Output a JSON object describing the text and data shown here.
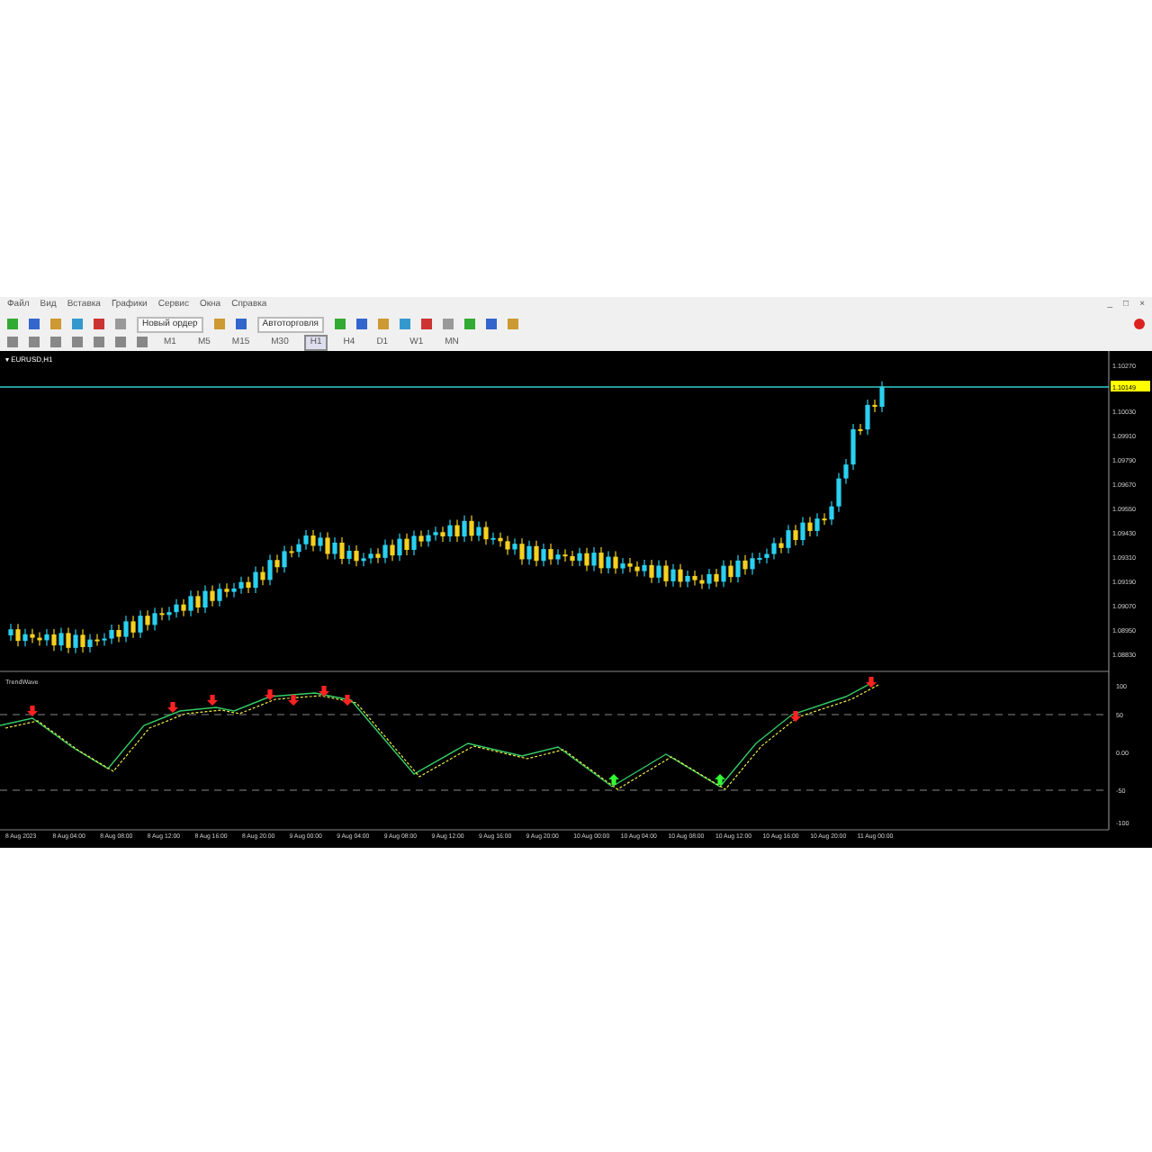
{
  "menu": [
    "Файл",
    "Вид",
    "Вставка",
    "Графики",
    "Сервис",
    "Окна",
    "Справка"
  ],
  "window_controls": [
    "_",
    "□",
    "×"
  ],
  "toolbar": {
    "buttons": [
      {
        "label": "Новый ордер"
      },
      {
        "label": "Автоторговля"
      }
    ]
  },
  "timeframes": [
    {
      "label": "M1",
      "selected": false
    },
    {
      "label": "M5",
      "selected": false
    },
    {
      "label": "M15",
      "selected": false
    },
    {
      "label": "M30",
      "selected": false
    },
    {
      "label": "H1",
      "selected": true
    },
    {
      "label": "H4",
      "selected": false
    },
    {
      "label": "D1",
      "selected": false
    },
    {
      "label": "W1",
      "selected": false
    },
    {
      "label": "MN",
      "selected": false
    }
  ],
  "chart": {
    "title": "▾ EURUSD,H1",
    "current_price": "1.10149",
    "price_labels": [
      "1.10270",
      "1.10030",
      "1.09910",
      "1.09790",
      "1.09670",
      "1.09550",
      "1.09430",
      "1.09310",
      "1.09190",
      "1.09070",
      "1.08950",
      "1.08830"
    ]
  },
  "indicator": {
    "name": "TrendWave",
    "levels": [
      "100",
      "50",
      "0.00",
      "-50",
      "-100"
    ]
  },
  "time_axis": [
    "8 Aug 2023",
    "8 Aug 04:00",
    "8 Aug 08:00",
    "8 Aug 12:00",
    "8 Aug 16:00",
    "8 Aug 20:00",
    "9 Aug 00:00",
    "9 Aug 04:00",
    "9 Aug 08:00",
    "9 Aug 12:00",
    "9 Aug 16:00",
    "9 Aug 20:00",
    "10 Aug 00:00",
    "10 Aug 04:00",
    "10 Aug 08:00",
    "10 Aug 12:00",
    "10 Aug 16:00",
    "10 Aug 20:00",
    "11 Aug 00:00"
  ]
}
